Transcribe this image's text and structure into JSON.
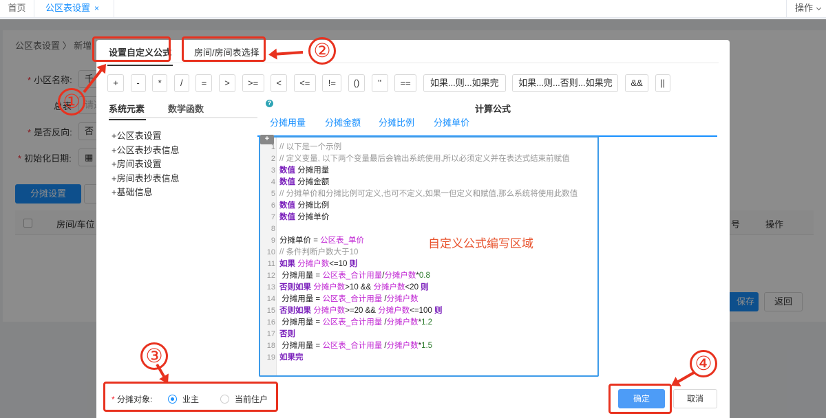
{
  "topbar": {
    "home_tab": "首页",
    "active_tab": "公区表设置",
    "close_glyph": "×",
    "ops_label": "操作"
  },
  "background_page": {
    "breadcrumb": "公区表设置  〉 新增",
    "label_community": "小区名称:",
    "community_value": "千",
    "label_total": "总表",
    "total_placeholder": "请选",
    "label_reverse": "是否反向:",
    "reverse_value": "否",
    "label_init_date": "初始化日期:",
    "btn_allocate": "分摊设置",
    "col_room": "房间/车位",
    "col_no": "号",
    "col_ops": "操作",
    "btn_save": "保存",
    "btn_back": "返回"
  },
  "dialog": {
    "tab_custom_formula": "设置自定义公式",
    "tab_room_select": "房间/房间表选择",
    "operators": [
      "+",
      "-",
      "*",
      "/",
      "=",
      ">",
      ">=",
      "<",
      "<=",
      "!=",
      "()",
      "''",
      "==",
      "如果...则...如果完",
      "如果...则...否则...如果完",
      "&&",
      "||"
    ],
    "left_tab_system": "系统元素",
    "left_tab_math": "数学函数",
    "tree_items": [
      "+公区表设置",
      "+公区表抄表信息",
      "+房间表设置",
      "+房间表抄表信息",
      "+基础信息"
    ],
    "help_glyph": "?",
    "calc_title": "计算公式",
    "calc_tabs": [
      "分摊用量",
      "分摊金额",
      "分摊比例",
      "分摊单价"
    ],
    "plus_glyph": "+",
    "editor_overlay_text": "自定义公式编写区域",
    "code_lines": [
      {
        "n": "1",
        "parts": [
          {
            "c": "cm",
            "t": "// 以下是一个示例"
          }
        ]
      },
      {
        "n": "2",
        "parts": [
          {
            "c": "cm",
            "t": "// 定义变量, 以下两个变量最后会输出系统使用,所以必须定义并在表达式结束前赋值"
          }
        ]
      },
      {
        "n": "3",
        "parts": [
          {
            "c": "kw",
            "t": "数值 "
          },
          {
            "c": "tx",
            "t": "分摊用量"
          }
        ]
      },
      {
        "n": "4",
        "parts": [
          {
            "c": "kw",
            "t": "数值 "
          },
          {
            "c": "tx",
            "t": "分摊金额"
          }
        ]
      },
      {
        "n": "5",
        "parts": [
          {
            "c": "cm",
            "t": "// 分摊单价和分摊比例可定义,也可不定义,如果一但定义和赋值,那么系统将使用此数值"
          }
        ]
      },
      {
        "n": "6",
        "parts": [
          {
            "c": "kw",
            "t": "数值 "
          },
          {
            "c": "tx",
            "t": "分摊比例"
          }
        ]
      },
      {
        "n": "7",
        "parts": [
          {
            "c": "kw",
            "t": "数值 "
          },
          {
            "c": "tx",
            "t": "分摊单价"
          }
        ]
      },
      {
        "n": "8",
        "parts": []
      },
      {
        "n": "9",
        "parts": [
          {
            "c": "tx",
            "t": "分摊单价 = "
          },
          {
            "c": "vr",
            "t": "公区表_单价"
          }
        ]
      },
      {
        "n": "10",
        "parts": [
          {
            "c": "cm",
            "t": "// 条件判断户数大于10"
          }
        ]
      },
      {
        "n": "11",
        "parts": [
          {
            "c": "kw",
            "t": "如果 "
          },
          {
            "c": "vr",
            "t": "分摊户数"
          },
          {
            "c": "tx",
            "t": "<=10 "
          },
          {
            "c": "kw",
            "t": "则"
          }
        ]
      },
      {
        "n": "12",
        "parts": [
          {
            "c": "tx",
            "t": "    分摊用量 =  "
          },
          {
            "c": "vr",
            "t": "公区表_合计用量"
          },
          {
            "c": "tx",
            "t": "/"
          },
          {
            "c": "vr",
            "t": "分摊户数"
          },
          {
            "c": "tx",
            "t": "*"
          },
          {
            "c": "nm",
            "t": "0.8"
          }
        ]
      },
      {
        "n": "13",
        "parts": [
          {
            "c": "kw",
            "t": "否则如果 "
          },
          {
            "c": "vr",
            "t": "分摊户数"
          },
          {
            "c": "tx",
            "t": ">10 && "
          },
          {
            "c": "vr",
            "t": "分摊户数"
          },
          {
            "c": "tx",
            "t": "<20 "
          },
          {
            "c": "kw",
            "t": "则"
          }
        ]
      },
      {
        "n": "14",
        "parts": [
          {
            "c": "tx",
            "t": "    分摊用量 =  "
          },
          {
            "c": "vr",
            "t": "公区表_合计用量"
          },
          {
            "c": "tx",
            "t": " /"
          },
          {
            "c": "vr",
            "t": "分摊户数"
          }
        ]
      },
      {
        "n": "15",
        "parts": [
          {
            "c": "kw",
            "t": "否则如果 "
          },
          {
            "c": "vr",
            "t": "分摊户数"
          },
          {
            "c": "tx",
            "t": ">=20 && "
          },
          {
            "c": "vr",
            "t": "分摊户数"
          },
          {
            "c": "tx",
            "t": "<=100 "
          },
          {
            "c": "kw",
            "t": "则"
          }
        ]
      },
      {
        "n": "16",
        "parts": [
          {
            "c": "tx",
            "t": "    分摊用量 =  "
          },
          {
            "c": "vr",
            "t": "公区表_合计用量"
          },
          {
            "c": "tx",
            "t": " /"
          },
          {
            "c": "vr",
            "t": "分摊户数"
          },
          {
            "c": "tx",
            "t": "*"
          },
          {
            "c": "nm",
            "t": "1.2"
          }
        ]
      },
      {
        "n": "17",
        "parts": [
          {
            "c": "kw",
            "t": "否则"
          }
        ]
      },
      {
        "n": "18",
        "parts": [
          {
            "c": "tx",
            "t": "    分摊用量 =  "
          },
          {
            "c": "vr",
            "t": "公区表_合计用量"
          },
          {
            "c": "tx",
            "t": " /"
          },
          {
            "c": "vr",
            "t": "分摊户数"
          },
          {
            "c": "tx",
            "t": "*"
          },
          {
            "c": "nm",
            "t": "1.5"
          }
        ]
      },
      {
        "n": "19",
        "parts": [
          {
            "c": "kw",
            "t": "如果完"
          }
        ]
      }
    ],
    "alloc_req_mark": "*",
    "alloc_label": "分摊对象:",
    "radio_owner": "业主",
    "radio_resident": "当前住户",
    "btn_ok": "确定",
    "btn_cancel": "取消"
  },
  "annotations": [
    "①",
    "②",
    "③",
    "④"
  ],
  "colors": {
    "accent": "#1890ff",
    "annotation_red": "#e8321f",
    "keyword_purple": "#7a1fbb",
    "variable_magenta": "#c026d3",
    "comment_gray": "#999999",
    "number_green": "#2a7a2a"
  }
}
